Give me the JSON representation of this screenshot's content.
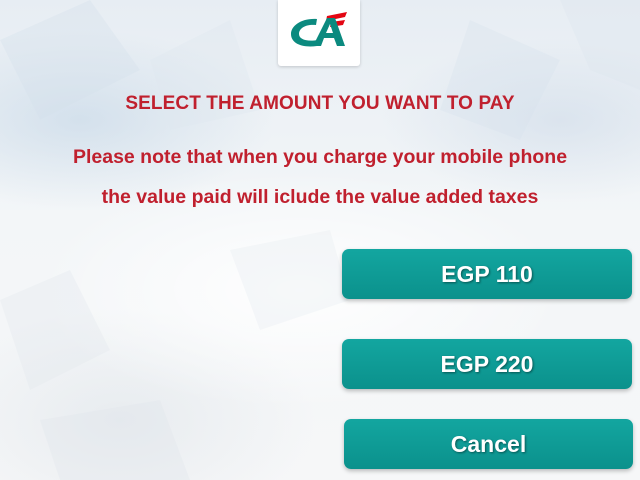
{
  "logo": {
    "name": "credit-agricole-logo",
    "colors": {
      "green": "#0b8a7f",
      "red": "#e30613"
    }
  },
  "heading": "SELECT THE AMOUNT YOU WANT TO PAY",
  "note": {
    "line1": "Please note that when you charge your mobile phone",
    "line2": "the value paid will iclude the value added taxes"
  },
  "amounts": [
    {
      "label": "EGP 110"
    },
    {
      "label": "EGP 220"
    }
  ],
  "cancel_label": "Cancel",
  "colors": {
    "text_accent": "#c0202e",
    "button": "#0e9a94",
    "button_text": "#ffffff"
  }
}
